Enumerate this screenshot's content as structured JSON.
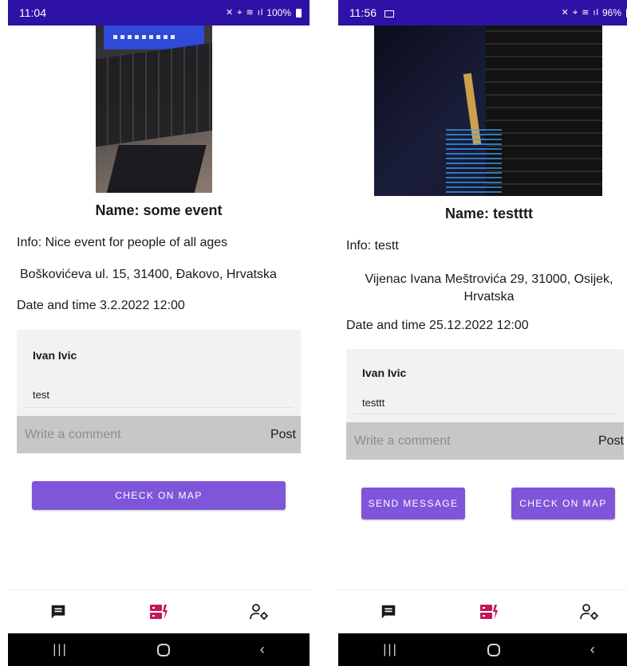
{
  "screens": [
    {
      "status": {
        "time": "11:04",
        "battery": "100%"
      },
      "event": {
        "name": "Name: some event",
        "info": "Info: Nice event for people of all ages",
        "address": "Boškovićeva ul. 15, 31400, Đakovo, Hrvatska",
        "datetime": "Date and time 3.2.2022 12:00"
      },
      "comments": [
        {
          "author": "Ivan Ivic",
          "text": "test"
        }
      ],
      "comment_input": {
        "placeholder": "Write a comment",
        "post_label": "Post"
      },
      "buttons": {
        "check_map": "CHECK ON MAP"
      },
      "nav": {
        "icons": [
          "message-icon",
          "events-icon",
          "profile-settings-icon"
        ],
        "active_color": "#c2185b"
      }
    },
    {
      "status": {
        "time": "11:56",
        "battery": "96%"
      },
      "event": {
        "name": "Name: testttt",
        "info": "Info: testt",
        "address": "Vijenac Ivana Meštrovića 29, 31000, Osijek, Hrvatska",
        "datetime": "Date and time 25.12.2022 12:00"
      },
      "comments": [
        {
          "author": "Ivan Ivic",
          "text": "testtt"
        }
      ],
      "comment_input": {
        "placeholder": "Write a comment",
        "post_label": "Post"
      },
      "buttons": {
        "send_message": "SEND MESSAGE",
        "check_map": "CHECK ON MAP"
      },
      "nav": {
        "icons": [
          "message-icon",
          "events-icon",
          "profile-settings-icon"
        ],
        "active_color": "#c2185b"
      }
    }
  ],
  "theme": {
    "status_bar": "#2e12a6",
    "button": "#7f56d9",
    "comment_bg": "#f2f2f2",
    "input_bg": "#c7c7c7"
  }
}
